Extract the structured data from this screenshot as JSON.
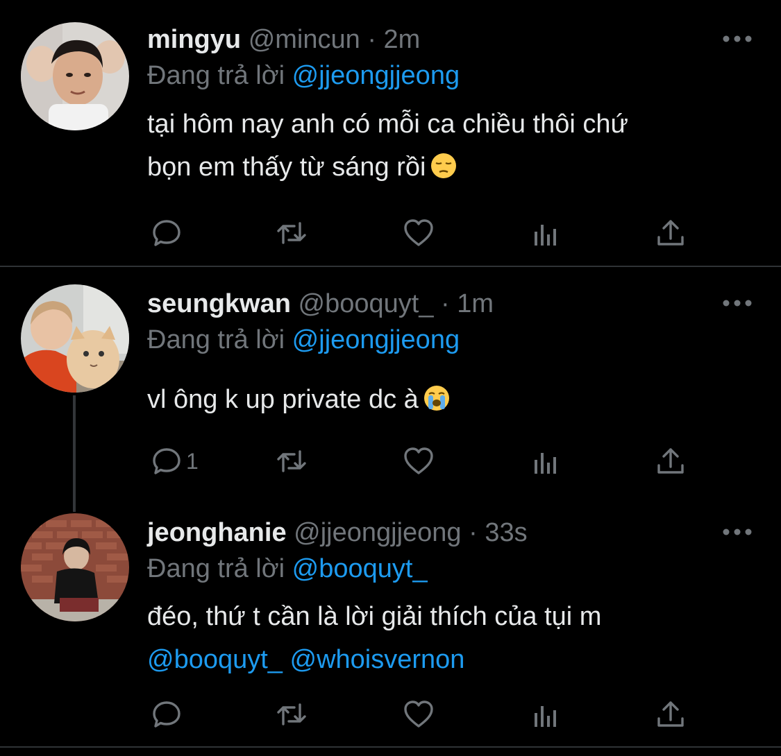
{
  "reply_prefix": "Đang trả lời",
  "tweets": [
    {
      "display_name": "mingyu",
      "handle": "@mincun",
      "sep": "·",
      "time": "2m",
      "reply_to": "@jjeongjjeong",
      "body_line1": "tại hôm nay anh có mỗi ca chiều thôi chứ",
      "body_line2": "bọn em thấy từ sáng rồi",
      "emoji": "pensive-face",
      "reply_count": ""
    },
    {
      "display_name": "seungkwan",
      "handle": "@booquyt_",
      "sep": "·",
      "time": "1m",
      "reply_to": "@jjeongjjeong",
      "body_line1": "vl ông k up private dc à",
      "emoji": "loudly-crying-face",
      "reply_count": "1"
    },
    {
      "display_name": "jeonghanie",
      "handle": "@jjeongjjeong",
      "sep": "·",
      "time": "33s",
      "reply_to": "@booquyt_",
      "body_line1": "đéo, thứ t cần là lời giải thích của tụi m",
      "mention_1": "@booquyt_",
      "mention_2": "@whoisvernon",
      "reply_count": ""
    }
  ],
  "colors": {
    "background": "#000000",
    "text": "#e7e9ea",
    "muted": "#71767b",
    "link": "#1d9bf0",
    "divider": "#2f3336"
  }
}
